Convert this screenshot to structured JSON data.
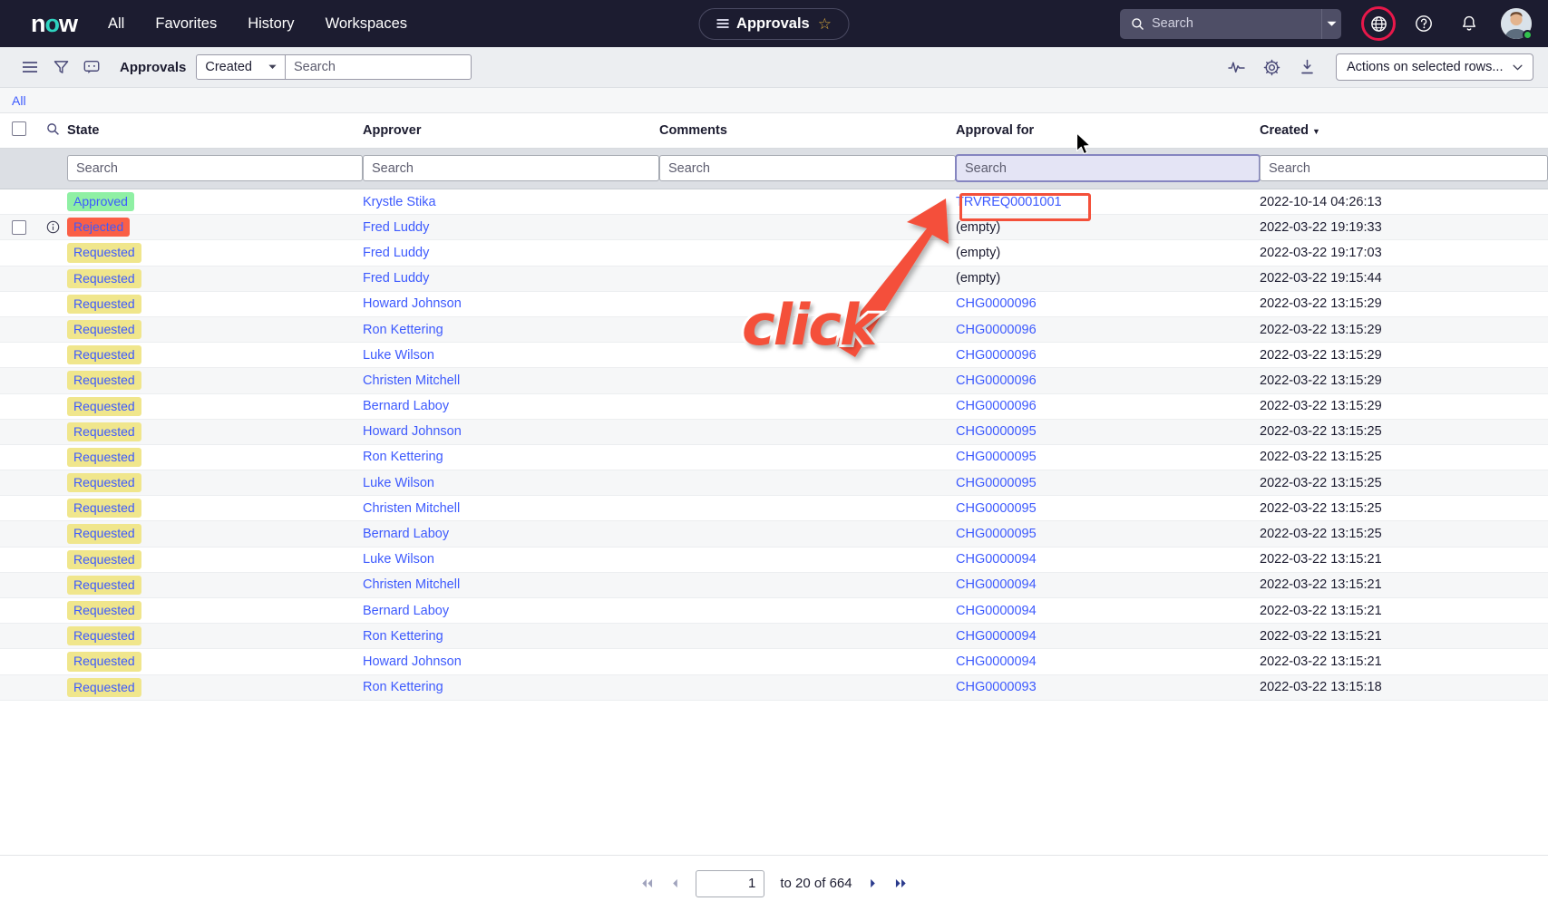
{
  "topnav": {
    "logo": "now",
    "links": [
      "All",
      "Favorites",
      "History",
      "Workspaces"
    ],
    "center_pill_title": "Approvals",
    "search_placeholder": "Search",
    "search_value": "",
    "icons": [
      "globe-icon",
      "help-icon",
      "notifications-icon",
      "avatar"
    ]
  },
  "toolbar": {
    "title": "Approvals",
    "filter_field": "Created",
    "search_placeholder": "Search",
    "search_value": "",
    "actions_label": "Actions on selected rows...",
    "icons": [
      "hamburger-menu-icon",
      "filter-icon",
      "comment-icon",
      "activity-icon",
      "settings-gear-icon",
      "download-icon"
    ]
  },
  "breadcrumb": {
    "all_label": "All"
  },
  "table": {
    "columns": [
      {
        "key": "state",
        "label": "State",
        "sorted": false
      },
      {
        "key": "approver",
        "label": "Approver",
        "sorted": false
      },
      {
        "key": "comments",
        "label": "Comments",
        "sorted": false
      },
      {
        "key": "for",
        "label": "Approval for",
        "sorted": false
      },
      {
        "key": "created",
        "label": "Created",
        "sorted": true
      }
    ],
    "filter_placeholder": "Search",
    "focused_filter": "for",
    "rows": [
      {
        "state": "Approved",
        "approver": "Krystle Stika",
        "comments": "",
        "for": "TRVREQ0001001",
        "for_link": true,
        "created": "2022-10-14 04:26:13"
      },
      {
        "state": "Rejected",
        "approver": "Fred Luddy",
        "comments": "",
        "for": "(empty)",
        "for_link": false,
        "created": "2022-03-22 19:19:33"
      },
      {
        "state": "Requested",
        "approver": "Fred Luddy",
        "comments": "",
        "for": "(empty)",
        "for_link": false,
        "created": "2022-03-22 19:17:03"
      },
      {
        "state": "Requested",
        "approver": "Fred Luddy",
        "comments": "",
        "for": "(empty)",
        "for_link": false,
        "created": "2022-03-22 19:15:44"
      },
      {
        "state": "Requested",
        "approver": "Howard Johnson",
        "comments": "",
        "for": "CHG0000096",
        "for_link": true,
        "created": "2022-03-22 13:15:29"
      },
      {
        "state": "Requested",
        "approver": "Ron Kettering",
        "comments": "",
        "for": "CHG0000096",
        "for_link": true,
        "created": "2022-03-22 13:15:29"
      },
      {
        "state": "Requested",
        "approver": "Luke Wilson",
        "comments": "",
        "for": "CHG0000096",
        "for_link": true,
        "created": "2022-03-22 13:15:29"
      },
      {
        "state": "Requested",
        "approver": "Christen Mitchell",
        "comments": "",
        "for": "CHG0000096",
        "for_link": true,
        "created": "2022-03-22 13:15:29"
      },
      {
        "state": "Requested",
        "approver": "Bernard Laboy",
        "comments": "",
        "for": "CHG0000096",
        "for_link": true,
        "created": "2022-03-22 13:15:29"
      },
      {
        "state": "Requested",
        "approver": "Howard Johnson",
        "comments": "",
        "for": "CHG0000095",
        "for_link": true,
        "created": "2022-03-22 13:15:25"
      },
      {
        "state": "Requested",
        "approver": "Ron Kettering",
        "comments": "",
        "for": "CHG0000095",
        "for_link": true,
        "created": "2022-03-22 13:15:25"
      },
      {
        "state": "Requested",
        "approver": "Luke Wilson",
        "comments": "",
        "for": "CHG0000095",
        "for_link": true,
        "created": "2022-03-22 13:15:25"
      },
      {
        "state": "Requested",
        "approver": "Christen Mitchell",
        "comments": "",
        "for": "CHG0000095",
        "for_link": true,
        "created": "2022-03-22 13:15:25"
      },
      {
        "state": "Requested",
        "approver": "Bernard Laboy",
        "comments": "",
        "for": "CHG0000095",
        "for_link": true,
        "created": "2022-03-22 13:15:25"
      },
      {
        "state": "Requested",
        "approver": "Luke Wilson",
        "comments": "",
        "for": "CHG0000094",
        "for_link": true,
        "created": "2022-03-22 13:15:21"
      },
      {
        "state": "Requested",
        "approver": "Christen Mitchell",
        "comments": "",
        "for": "CHG0000094",
        "for_link": true,
        "created": "2022-03-22 13:15:21"
      },
      {
        "state": "Requested",
        "approver": "Bernard Laboy",
        "comments": "",
        "for": "CHG0000094",
        "for_link": true,
        "created": "2022-03-22 13:15:21"
      },
      {
        "state": "Requested",
        "approver": "Ron Kettering",
        "comments": "",
        "for": "CHG0000094",
        "for_link": true,
        "created": "2022-03-22 13:15:21"
      },
      {
        "state": "Requested",
        "approver": "Howard Johnson",
        "comments": "",
        "for": "CHG0000094",
        "for_link": true,
        "created": "2022-03-22 13:15:21"
      },
      {
        "state": "Requested",
        "approver": "Ron Kettering",
        "comments": "",
        "for": "CHG0000093",
        "for_link": true,
        "created": "2022-03-22 13:15:18"
      }
    ],
    "hover_row_index": 1
  },
  "annotation": {
    "click_label": "click"
  },
  "footer": {
    "page_value": "1",
    "range_text": "to 20 of 664"
  },
  "colors": {
    "brand_teal": "#2fd3c0",
    "link_blue": "#3d5afe",
    "approved_green": "#8ff0a4",
    "rejected_red": "#fa5f46",
    "requested_yellow": "#f0e68c",
    "annotation_red": "#f4503a",
    "nav_dark": "#1c1c30"
  }
}
